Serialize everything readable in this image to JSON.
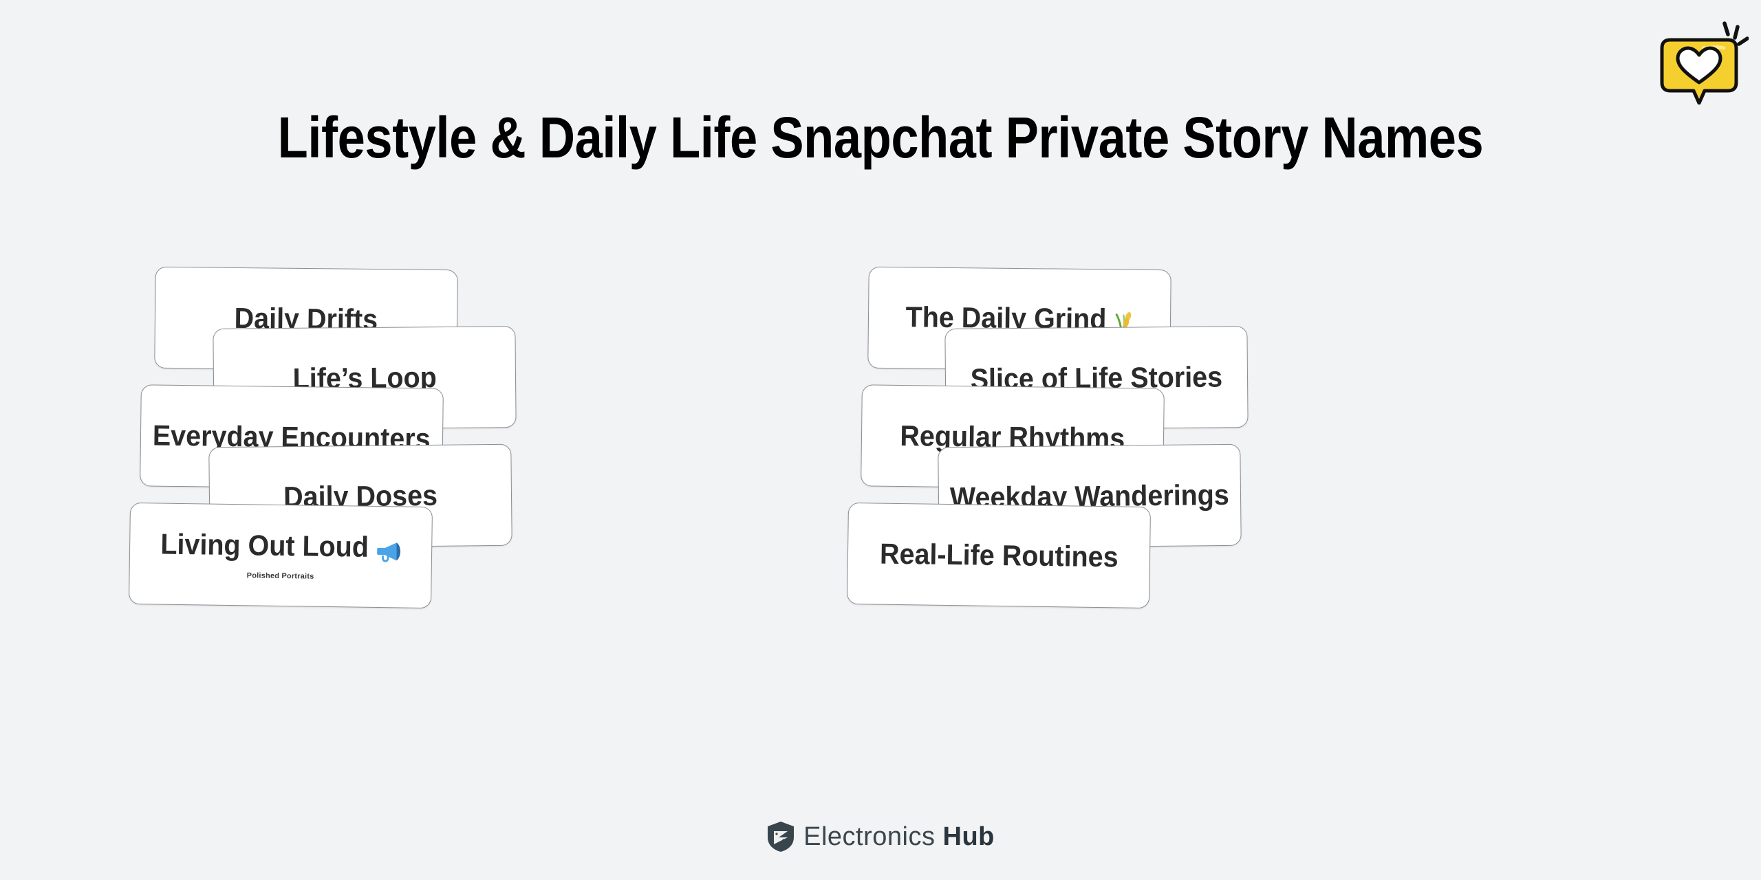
{
  "page": {
    "title": "Lifestyle & Daily Life Snapchat Private Story Names",
    "background_color": "#f2f3f5"
  },
  "badge": {
    "icon": "heart-speech-bubble-icon",
    "bubble_color": "#f5cf2e",
    "heart_color": "#ffffff",
    "outline_color": "#111111"
  },
  "columns": [
    {
      "name": "left-column",
      "cards": [
        {
          "label": "Daily Drifts",
          "emoji": "",
          "subtext": ""
        },
        {
          "label": "Life’s Loop",
          "emoji": "",
          "subtext": ""
        },
        {
          "label": "Everyday Encounters",
          "emoji": "",
          "subtext": ""
        },
        {
          "label": "Daily Doses",
          "emoji": "",
          "subtext": ""
        },
        {
          "label": "Living Out Loud",
          "emoji": "megaphone-icon",
          "subtext": "Polished Portraits"
        }
      ]
    },
    {
      "name": "right-column",
      "cards": [
        {
          "label": "The Daily Grind",
          "emoji": "herb-icon",
          "subtext": ""
        },
        {
          "label": "Slice of Life Stories",
          "emoji": "",
          "subtext": ""
        },
        {
          "label": "Regular Rhythms",
          "emoji": "",
          "subtext": ""
        },
        {
          "label": "Weekday Wanderings",
          "emoji": "",
          "subtext": ""
        },
        {
          "label": "Real-Life Routines",
          "emoji": "",
          "subtext": ""
        }
      ]
    }
  ],
  "footer": {
    "logo_icon": "shield-logo-icon",
    "brand_light": "Electronics",
    "brand_bold": "Hub",
    "brand_color": "#3a454d"
  }
}
